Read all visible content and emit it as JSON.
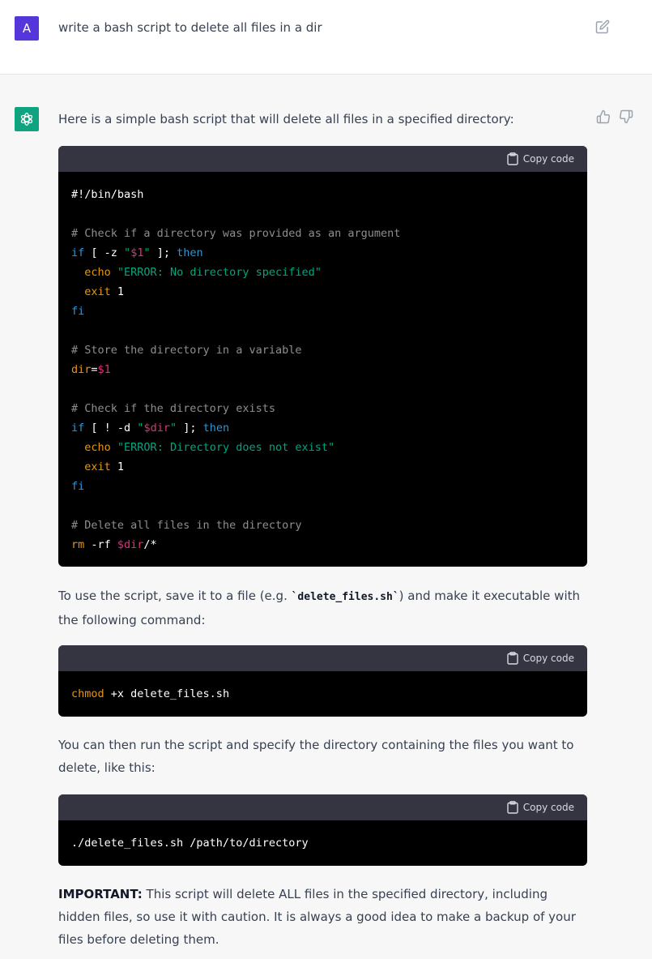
{
  "user": {
    "avatar_letter": "A",
    "prompt": "write a bash script to delete all files in a dir"
  },
  "assistant": {
    "intro": "Here is a simple bash script that will delete all files in a specified directory:",
    "copy_label": "Copy code",
    "code1": [
      [
        {
          "t": "#!/bin/bash",
          "c": "plain"
        }
      ],
      [],
      [
        {
          "t": "# Check if a directory was provided as an argument",
          "c": "comment"
        }
      ],
      [
        {
          "t": "if",
          "c": "kw"
        },
        {
          "t": " [ -z ",
          "c": "plain"
        },
        {
          "t": "\"",
          "c": "str"
        },
        {
          "t": "$1",
          "c": "var"
        },
        {
          "t": "\"",
          "c": "str"
        },
        {
          "t": " ]; ",
          "c": "plain"
        },
        {
          "t": "then",
          "c": "kw"
        }
      ],
      [
        {
          "t": "  ",
          "c": "plain"
        },
        {
          "t": "echo",
          "c": "builtin"
        },
        {
          "t": " ",
          "c": "plain"
        },
        {
          "t": "\"ERROR: No directory specified\"",
          "c": "str"
        }
      ],
      [
        {
          "t": "  ",
          "c": "plain"
        },
        {
          "t": "exit",
          "c": "builtin"
        },
        {
          "t": " 1",
          "c": "plain"
        }
      ],
      [
        {
          "t": "fi",
          "c": "kw"
        }
      ],
      [],
      [
        {
          "t": "# Store the directory in a variable",
          "c": "comment"
        }
      ],
      [
        {
          "t": "dir",
          "c": "builtin"
        },
        {
          "t": "=",
          "c": "plain"
        },
        {
          "t": "$1",
          "c": "var"
        }
      ],
      [],
      [
        {
          "t": "# Check if the directory exists",
          "c": "comment"
        }
      ],
      [
        {
          "t": "if",
          "c": "kw"
        },
        {
          "t": " [ ! -d ",
          "c": "plain"
        },
        {
          "t": "\"",
          "c": "str"
        },
        {
          "t": "$dir",
          "c": "var"
        },
        {
          "t": "\"",
          "c": "str"
        },
        {
          "t": " ]; ",
          "c": "plain"
        },
        {
          "t": "then",
          "c": "kw"
        }
      ],
      [
        {
          "t": "  ",
          "c": "plain"
        },
        {
          "t": "echo",
          "c": "builtin"
        },
        {
          "t": " ",
          "c": "plain"
        },
        {
          "t": "\"ERROR: Directory does not exist\"",
          "c": "str"
        }
      ],
      [
        {
          "t": "  ",
          "c": "plain"
        },
        {
          "t": "exit",
          "c": "builtin"
        },
        {
          "t": " 1",
          "c": "plain"
        }
      ],
      [
        {
          "t": "fi",
          "c": "kw"
        }
      ],
      [],
      [
        {
          "t": "# Delete all files in the directory",
          "c": "comment"
        }
      ],
      [
        {
          "t": "rm",
          "c": "builtin"
        },
        {
          "t": " -rf ",
          "c": "plain"
        },
        {
          "t": "$dir",
          "c": "var"
        },
        {
          "t": "/*",
          "c": "plain"
        }
      ]
    ],
    "para2_pre": "To use the script, save it to a file (e.g. ",
    "para2_code": "`delete_files.sh`",
    "para2_post": ") and make it executable with the following command:",
    "code2": [
      [
        {
          "t": "chmod",
          "c": "builtin"
        },
        {
          "t": " +x delete_files.sh",
          "c": "plain"
        }
      ]
    ],
    "para3": "You can then run the script and specify the directory containing the files you want to delete, like this:",
    "code3": [
      [
        {
          "t": "./delete_files.sh /path/to/directory",
          "c": "plain"
        }
      ]
    ],
    "para4_bold": "IMPORTANT:",
    "para4_rest": " This script will delete ALL files in the specified directory, including hidden files, so use it with caution. It is always a good idea to make a backup of your files before deleting them."
  },
  "colors": {
    "user_avatar": "#5436da",
    "assistant_avatar": "#10a37f",
    "code_bg": "#000000",
    "code_header": "#343541"
  }
}
